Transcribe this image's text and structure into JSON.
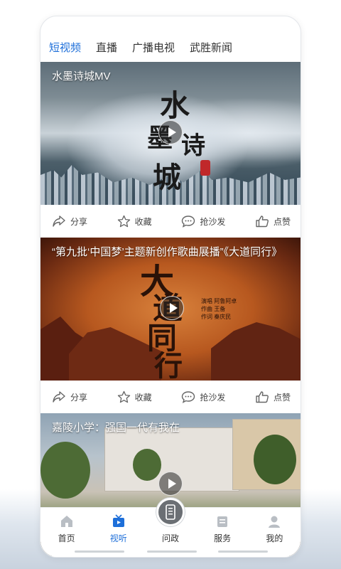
{
  "tabs": [
    {
      "label": "短视频",
      "active": true
    },
    {
      "label": "直播",
      "active": false
    },
    {
      "label": "广播电视",
      "active": false
    },
    {
      "label": "武胜新闻",
      "active": false
    }
  ],
  "videos": [
    {
      "title": "水墨诗城MV",
      "calligraphy": [
        "水",
        "墨",
        "诗",
        "城"
      ],
      "seal_text": "武胜"
    },
    {
      "title": "“第九批‘中国梦’主题新创作歌曲展播”《大道同行》",
      "calligraphy": [
        "大",
        "道",
        "同",
        "行"
      ],
      "credits": [
        "演唱  阿鲁阿卓",
        "作曲  王备",
        "作词  秦庆民"
      ]
    },
    {
      "title": "嘉陵小学：强国一代有我在"
    }
  ],
  "actions": {
    "share": "分享",
    "favorite": "收藏",
    "comment": "抢沙发",
    "like": "点赞"
  },
  "nav": {
    "items": [
      {
        "label": "首页",
        "icon": "home-icon",
        "active": false
      },
      {
        "label": "视听",
        "icon": "tv-icon",
        "active": true
      },
      {
        "label": "问政",
        "icon": "phone-icon",
        "active": false
      },
      {
        "label": "服务",
        "icon": "service-icon",
        "active": false
      },
      {
        "label": "我的",
        "icon": "user-icon",
        "active": false
      }
    ]
  },
  "colors": {
    "accent": "#1e6fd9"
  }
}
